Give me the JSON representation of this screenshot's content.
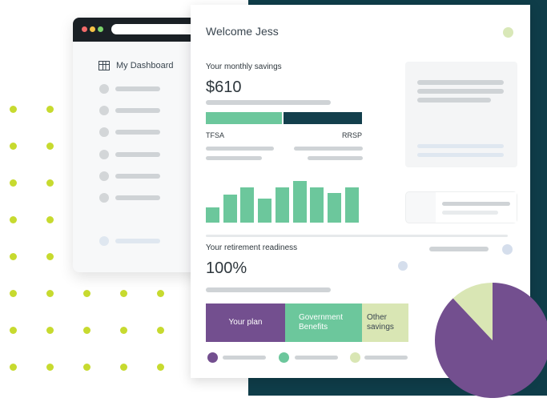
{
  "colors": {
    "dark_bg": "#0f3d49",
    "accent_green": "#6cc79c",
    "dark_teal": "#133f4c",
    "purple": "#734f8f",
    "light_green": "#d9e6b4",
    "dot_lime": "#c7da2f"
  },
  "sidebar": {
    "dashboard_icon": "grid-icon",
    "dashboard_label": "My Dashboard"
  },
  "header": {
    "welcome": "Welcome Jess"
  },
  "savings": {
    "label": "Your monthly savings",
    "amount": "$610",
    "tfsa_label": "TFSA",
    "rrsp_label": "RRSP",
    "tfsa_share": 0.49,
    "rrsp_share": 0.51,
    "chart_values": [
      18,
      34,
      42,
      29,
      42,
      50,
      42,
      36,
      42
    ]
  },
  "retirement": {
    "label": "Your retirement readiness",
    "percent": "100%",
    "segments": [
      {
        "label": "Your plan",
        "share": 0.39
      },
      {
        "label": "Government Benefits",
        "share": 0.38
      },
      {
        "label": "Other savings",
        "share": 0.23
      }
    ],
    "pie_shares": [
      0.88,
      0.12
    ]
  }
}
